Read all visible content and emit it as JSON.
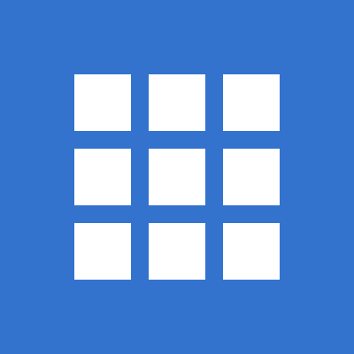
{
  "icon": {
    "name": "app-grid-icon",
    "background_color": "#3373CE",
    "cell_color": "#FFFFFF",
    "grid": {
      "rows": 3,
      "columns": 3
    }
  }
}
